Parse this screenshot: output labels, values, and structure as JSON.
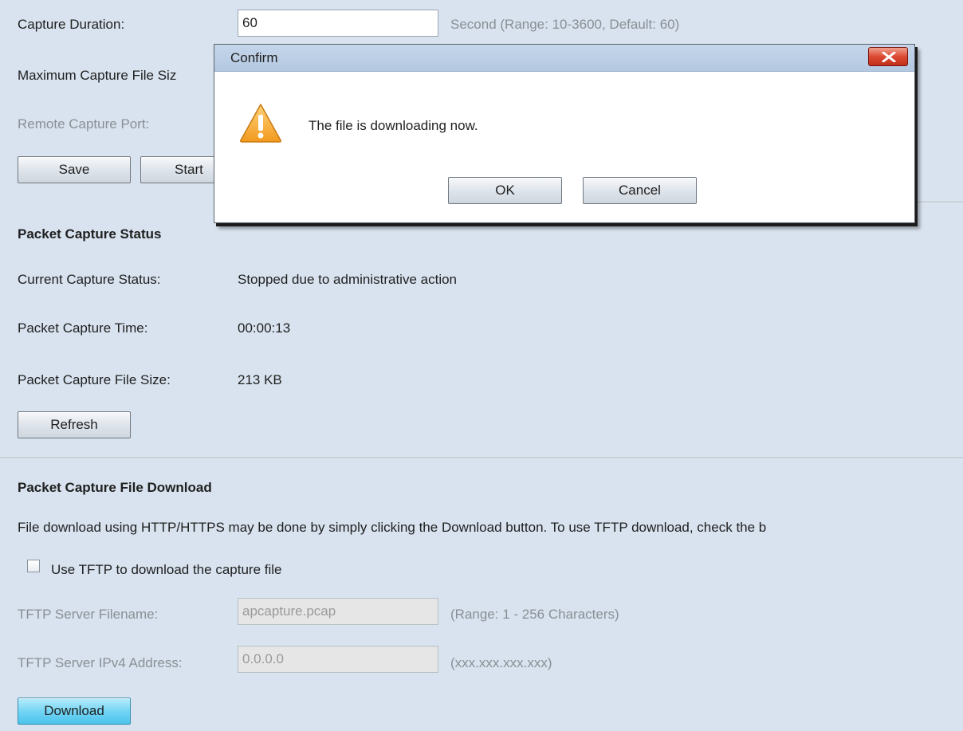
{
  "capture_settings": {
    "duration_label": "Capture Duration:",
    "duration_value": "60",
    "duration_hint": "Second (Range: 10-3600, Default: 60)",
    "max_file_size_label": "Maximum Capture File Siz",
    "remote_port_label": "Remote Capture Port:",
    "save_label": "Save",
    "start_label": "Start"
  },
  "dialog": {
    "title": "Confirm",
    "message": "The file is downloading now.",
    "ok_label": "OK",
    "cancel_label": "Cancel",
    "icon": "warning-icon"
  },
  "status": {
    "heading": "Packet Capture Status",
    "current_label": "Current Capture Status:",
    "current_value": "Stopped due to administrative action",
    "time_label": "Packet Capture Time:",
    "time_value": "00:00:13",
    "size_label": "Packet Capture File Size:",
    "size_value": "213 KB",
    "refresh_label": "Refresh"
  },
  "download": {
    "heading": "Packet Capture File Download",
    "description": "File download using HTTP/HTTPS may be done by simply clicking the Download button. To use TFTP download, check the b",
    "tftp_checkbox_label": "Use TFTP to download the capture file",
    "tftp_checked": false,
    "filename_label": "TFTP Server Filename:",
    "filename_value": "apcapture.pcap",
    "filename_hint": "(Range: 1 - 256 Characters)",
    "ipv4_label": "TFTP Server IPv4 Address:",
    "ipv4_value": "0.0.0.0",
    "ipv4_hint": "(xxx.xxx.xxx.xxx)",
    "download_label": "Download"
  },
  "colors": {
    "page_background": "#d8e3ef",
    "dialog_titlebar": "#b3c8e1",
    "primary_button": "#6fd3f3",
    "close_button": "#dc4a33",
    "warning_icon": "#f5a623"
  }
}
